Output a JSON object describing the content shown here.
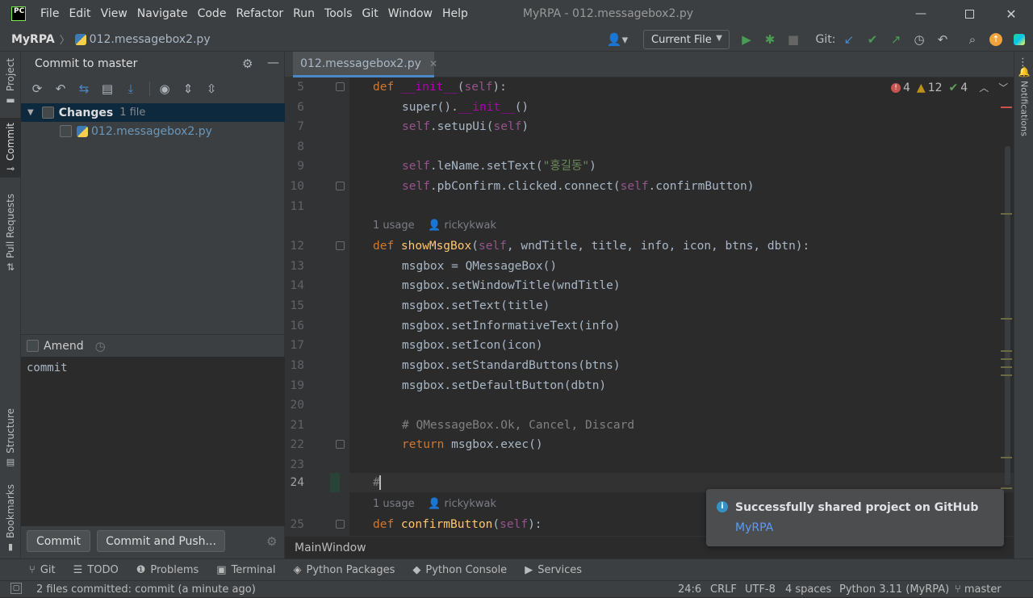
{
  "menu": {
    "items": [
      "File",
      "Edit",
      "View",
      "Navigate",
      "Code",
      "Refactor",
      "Run",
      "Tools",
      "Git",
      "Window",
      "Help"
    ],
    "window_title": "MyRPA - 012.messagebox2.py",
    "logo_text": "PC"
  },
  "navbar": {
    "project": "MyRPA",
    "file": "012.messagebox2.py",
    "run_config": "Current File",
    "git_label": "Git:"
  },
  "left_strip": {
    "tabs": [
      "Project",
      "Commit",
      "Pull Requests",
      "Structure",
      "Bookmarks"
    ]
  },
  "commit_panel": {
    "title": "Commit to master",
    "changes_label": "Changes",
    "changes_count": "1 file",
    "file_name": "012.messagebox2.py",
    "amend_label": "Amend",
    "message": "commit",
    "commit_button": "Commit",
    "commit_push_button": "Commit and Push..."
  },
  "editor": {
    "tab_label": "012.messagebox2.py",
    "inspections": {
      "errors": "4",
      "warnings": "12",
      "ok": "4"
    },
    "inlay_usage": "1 usage",
    "inlay_author": "rickykwak",
    "line_numbers": [
      "5",
      "6",
      "7",
      "8",
      "9",
      "10",
      "11",
      "12",
      "13",
      "14",
      "15",
      "16",
      "17",
      "18",
      "19",
      "20",
      "21",
      "22",
      "23",
      "24",
      "25"
    ],
    "code": {
      "l5_kw": "def ",
      "l5_fn": "__init__",
      "l5_p1": "(",
      "l5_self": "self",
      "l5_p2": "):",
      "l6_a": "super().",
      "l6_fn": "__init__",
      "l6_b": "()",
      "l7_self": "self",
      "l7_a": ".setupUi(",
      "l7_self2": "self",
      "l7_b": ")",
      "l9_self": "self",
      "l9_a": ".leName.setText(",
      "l9_str": "\"홍길동\"",
      "l9_b": ")",
      "l10_self": "self",
      "l10_a": ".pbConfirm.clicked.connect(",
      "l10_self2": "self",
      "l10_b": ".confirmButton)",
      "l12_kw": "def ",
      "l12_fn": "showMsgBox",
      "l12_p1": "(",
      "l12_self": "self",
      "l12_rest": ", wndTitle, title, info, icon, btns, dbtn):",
      "l13": "msgbox = QMessageBox()",
      "l14": "msgbox.setWindowTitle(wndTitle)",
      "l15": "msgbox.setText(title)",
      "l16": "msgbox.setInformativeText(info)",
      "l17": "msgbox.setIcon(icon)",
      "l18": "msgbox.setStandardButtons(btns)",
      "l19": "msgbox.setDefaultButton(dbtn)",
      "l21_cm": "# QMessageBox.Ok, Cancel, Discard",
      "l22_kw": "return ",
      "l22_rest": "msgbox.exec()",
      "l24": "#",
      "l25_kw": "def ",
      "l25_fn": "confirmButton",
      "l25_p1": "(",
      "l25_self": "self",
      "l25_p2": "):"
    },
    "breadcrumb": "MainWindow"
  },
  "right_strip": {
    "label": "Notifications"
  },
  "notification": {
    "title": "Successfully shared project on GitHub",
    "link": "MyRPA"
  },
  "bottom_tools": [
    "Git",
    "TODO",
    "Problems",
    "Terminal",
    "Python Packages",
    "Python Console",
    "Services"
  ],
  "status": {
    "message": "2 files committed: commit (a minute ago)",
    "position": "24:6",
    "line_sep": "CRLF",
    "encoding": "UTF-8",
    "indent": "4 spaces",
    "interpreter": "Python 3.11 (MyRPA)",
    "branch": "master"
  },
  "colors": {
    "accent": "#4a88c7",
    "keyword": "#cc7832",
    "function": "#ffc66d",
    "self": "#94558d",
    "string": "#6a8759",
    "comment": "#808080",
    "run_green": "#499c54"
  }
}
